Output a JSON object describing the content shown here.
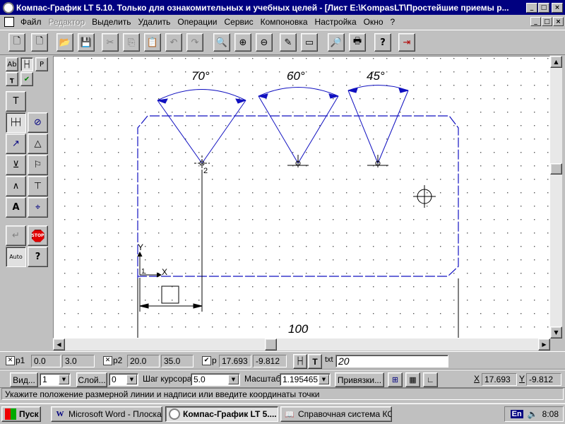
{
  "window": {
    "title": "Компас-График LT 5.10. Только для ознакомительных и учебных целей - [Лист E:\\KompasLT\\Простейшие приемы р...",
    "buttons": {
      "minimize": "_",
      "maximize": "□",
      "close": "×"
    }
  },
  "menu": {
    "items": [
      {
        "label": "Файл",
        "enabled": true
      },
      {
        "label": "Редактор",
        "enabled": false
      },
      {
        "label": "Выделить",
        "enabled": true
      },
      {
        "label": "Удалить",
        "enabled": true
      },
      {
        "label": "Операции",
        "enabled": true
      },
      {
        "label": "Сервис",
        "enabled": true
      },
      {
        "label": "Компоновка",
        "enabled": true
      },
      {
        "label": "Настройка",
        "enabled": true
      },
      {
        "label": "Окно",
        "enabled": true
      },
      {
        "label": "?",
        "enabled": true
      }
    ]
  },
  "toolbar": {
    "buttons": [
      {
        "name": "new-sheet",
        "icon": "new-sheet-icon",
        "glyph": "🗋"
      },
      {
        "name": "new-fragment",
        "icon": "new-fragment-icon",
        "glyph": "🗋"
      },
      {
        "name": "open",
        "icon": "open-folder-icon",
        "glyph": "📂"
      },
      {
        "name": "save",
        "icon": "save-icon",
        "glyph": "💾"
      },
      {
        "name": "cut",
        "icon": "cut-icon",
        "glyph": "✂"
      },
      {
        "name": "copy",
        "icon": "copy-icon",
        "glyph": "⎘"
      },
      {
        "name": "paste",
        "icon": "paste-icon",
        "glyph": "📋"
      },
      {
        "name": "undo",
        "icon": "undo-icon",
        "glyph": "↶"
      },
      {
        "name": "redo",
        "icon": "redo-icon",
        "glyph": "↷"
      },
      {
        "name": "zoom-window",
        "icon": "zoom-window-icon",
        "glyph": "🔍"
      },
      {
        "name": "zoom-in",
        "icon": "zoom-in-icon",
        "glyph": "⊕"
      },
      {
        "name": "zoom-out",
        "icon": "zoom-out-icon",
        "glyph": "⊖"
      },
      {
        "name": "redraw",
        "icon": "redraw-icon",
        "glyph": "✎"
      },
      {
        "name": "show-all",
        "icon": "show-all-icon",
        "glyph": "▭"
      },
      {
        "name": "print-preview",
        "icon": "print-preview-icon",
        "glyph": "🔎"
      },
      {
        "name": "print",
        "icon": "print-icon",
        "glyph": "🖶"
      },
      {
        "name": "context-help",
        "icon": "context-help-icon",
        "glyph": "?"
      },
      {
        "name": "exit",
        "icon": "exit-icon",
        "glyph": "⇥"
      }
    ]
  },
  "left_tools": {
    "tabs": [
      "Аb",
      "├┤",
      "P"
    ],
    "secondary": [
      "┱",
      "✔"
    ],
    "tools": [
      "T",
      "├┼┤",
      "⊘",
      "↗",
      "△",
      "⊻",
      "⚐",
      "∧",
      "⊤",
      "A",
      "⌖"
    ],
    "bottom": {
      "enter": "↵",
      "stop": "STOP",
      "auto": "Auto",
      "help": "?"
    }
  },
  "drawing": {
    "angle_labels": [
      "70°",
      "60°",
      "45°"
    ],
    "dimension_label": "100",
    "axis_y_label": "Y",
    "axis_x_label": "X",
    "axis_origin_label": "1",
    "point_label": "2"
  },
  "status_row1": {
    "p1_label": "p1",
    "p1_x": "0.0",
    "p1_y": "3.0",
    "p2_label": "p2",
    "p2_x": "20.0",
    "p2_y": "35.0",
    "p_label": "p",
    "p_x": "17.693",
    "p_y": "-9.812",
    "txt_label": "txt",
    "txt_value": "20"
  },
  "status_row2": {
    "view_label": "Вид...",
    "view_value": "1",
    "layer_label": "Слой...",
    "layer_value": "0",
    "step_label": "Шаг курсора",
    "step_value": "5.0",
    "scale_label": "Масштаб",
    "scale_value": "1.195465",
    "snaps_label": "Привязки...",
    "x_label": "X",
    "x_value": "17.693",
    "y_label": "Y",
    "y_value": "-9.812"
  },
  "hint": "Укажите положение размерной линии и надписи или введите координаты точки",
  "taskbar": {
    "start": "Пуск",
    "tasks": [
      {
        "label": "Microsoft Word - Плоская...",
        "active": false
      },
      {
        "label": "Компас-График LT 5....",
        "active": true
      },
      {
        "label": "Справочная система КО...",
        "active": false
      }
    ],
    "lang": "En",
    "time": "8:08"
  },
  "colors": {
    "title_bg": "#000080",
    "drawing_line": "#1010c0",
    "aux_line": "#000000",
    "face": "#c0c0c0"
  }
}
